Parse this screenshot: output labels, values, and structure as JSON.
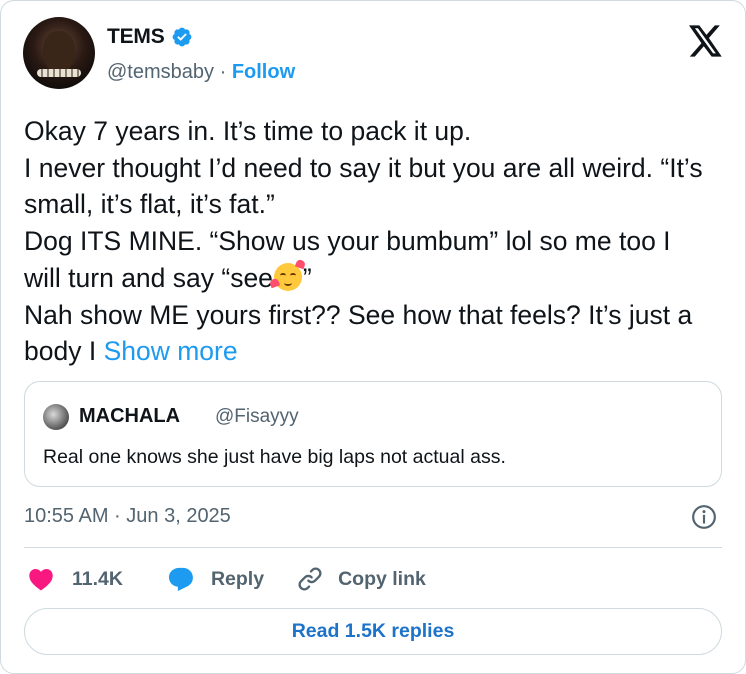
{
  "author": {
    "name": "TEMS",
    "handle": "@temsbaby",
    "separator": "·",
    "follow_label": "Follow",
    "verified": true,
    "avatar_icon": "profile-photo"
  },
  "tweet": {
    "lines": [
      "Okay 7 years in. It’s time to pack it up.",
      "I never thought I’d need to say it but you are all weird. “It’s small, it’s flat, it’s fat.”",
      "Dog ITS MINE. “Show us your bumbum” lol so me too I will turn and say “see",
      "”",
      "Nah show ME yours first?? See how that feels? It’s just a body I "
    ],
    "emoji": "smiling-face-with-hearts",
    "show_more": "Show more"
  },
  "quote": {
    "name": "MACHALA",
    "handle": "@Fisayyy",
    "text": "Real one knows she just have big laps not actual ass."
  },
  "meta": {
    "timestamp": "10:55 AM · Jun 3, 2025"
  },
  "actions": {
    "like_count": "11.4K",
    "reply_label": "Reply",
    "copy_label": "Copy link"
  },
  "footer": {
    "read_replies": "Read 1.5K replies"
  },
  "colors": {
    "accent": "#1d9bf0",
    "like": "#f91880",
    "text": "#0f1419",
    "muted": "#536471",
    "border": "#cfd9de"
  }
}
